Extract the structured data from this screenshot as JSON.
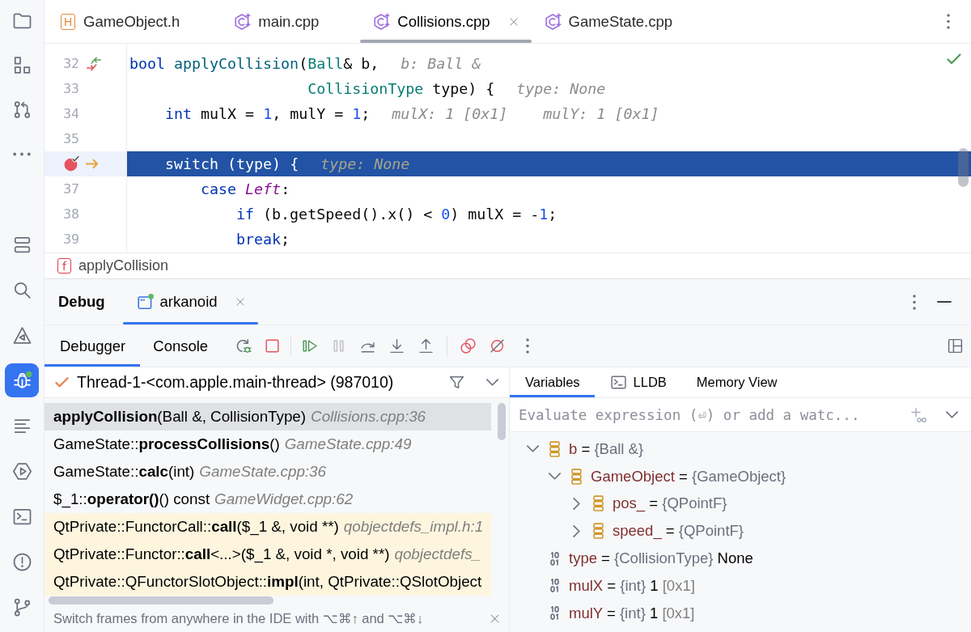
{
  "sidebar": {
    "top": [
      {
        "selected": false
      },
      {
        "selected": false
      },
      {
        "selected": false
      },
      {
        "selected": false
      }
    ],
    "bottom": [
      {
        "selected": false
      },
      {
        "selected": false
      },
      {
        "selected": false
      },
      {
        "selected": true
      },
      {
        "selected": false
      },
      {
        "selected": false
      },
      {
        "selected": false
      },
      {
        "selected": false
      },
      {
        "selected": false
      }
    ]
  },
  "editor": {
    "tabs": [
      {
        "label": "GameObject.h",
        "kind": "header",
        "badge": "H",
        "selected": false
      },
      {
        "label": "main.cpp",
        "kind": "source",
        "selected": false
      },
      {
        "label": "Collisions.cpp",
        "kind": "source",
        "selected": true
      },
      {
        "label": "GameState.cpp",
        "kind": "source",
        "selected": false
      }
    ],
    "lines": [
      {
        "number": "32",
        "navigation_marker": true,
        "breakpoint": false,
        "current": false,
        "tokens": [
          {
            "text": "bool",
            "kind": "keyword"
          },
          {
            "text": " applyCollision",
            "kind": "function"
          },
          {
            "text": "(",
            "kind": "plain"
          },
          {
            "text": "Ball",
            "kind": "type"
          },
          {
            "text": "& b,",
            "kind": "plain"
          }
        ],
        "hints": [
          "b: Ball &"
        ]
      },
      {
        "number": "33",
        "navigation_marker": false,
        "breakpoint": false,
        "current": false,
        "tokens": [
          {
            "text": "                    CollisionType",
            "kind": "type"
          },
          {
            "text": " type) {",
            "kind": "plain"
          }
        ],
        "hints": [
          "type: None"
        ]
      },
      {
        "number": "34",
        "navigation_marker": false,
        "breakpoint": false,
        "current": false,
        "tokens": [
          {
            "text": "    int",
            "kind": "keyword"
          },
          {
            "text": " mulX = ",
            "kind": "plain"
          },
          {
            "text": "1",
            "kind": "number"
          },
          {
            "text": ", mulY = ",
            "kind": "plain"
          },
          {
            "text": "1",
            "kind": "number"
          },
          {
            "text": ";",
            "kind": "plain"
          }
        ],
        "hints": [
          "mulX: 1 [0x1]",
          "mulY: 1 [0x1]"
        ]
      },
      {
        "number": "35",
        "navigation_marker": false,
        "breakpoint": false,
        "current": false
      },
      {
        "navigation_marker": false,
        "breakpoint": true,
        "current": true,
        "tokens": [
          {
            "text": "    switch",
            "kind": "keyword"
          },
          {
            "text": " (type) {",
            "kind": "plain"
          }
        ],
        "hints": [
          "type: None"
        ]
      },
      {
        "number": "37",
        "navigation_marker": false,
        "breakpoint": false,
        "current": false,
        "tokens": [
          {
            "text": "        case",
            "kind": "keyword"
          },
          {
            "text": " Left",
            "kind": "constant"
          },
          {
            "text": ":",
            "kind": "plain"
          }
        ]
      },
      {
        "number": "38",
        "navigation_marker": false,
        "breakpoint": false,
        "current": false,
        "tokens": [
          {
            "text": "            if",
            "kind": "keyword"
          },
          {
            "text": " (b.getSpeed().x() < ",
            "kind": "plain"
          },
          {
            "text": "0",
            "kind": "number"
          },
          {
            "text": ") mulX = -",
            "kind": "plain"
          },
          {
            "text": "1",
            "kind": "number"
          },
          {
            "text": ";",
            "kind": "plain"
          }
        ]
      },
      {
        "number": "39",
        "navigation_marker": false,
        "breakpoint": false,
        "current": false,
        "tokens": [
          {
            "text": "            break",
            "kind": "keyword"
          },
          {
            "text": ";",
            "kind": "plain"
          }
        ]
      }
    ]
  },
  "breadcrumb": {
    "badge": "f",
    "label": "applyCollision"
  },
  "debug": {
    "title": "Debug",
    "session_tabs": [
      {
        "label": "arkanoid",
        "selected": true
      }
    ],
    "view_tabs": [
      {
        "label": "Debugger",
        "selected": true
      },
      {
        "label": "Console",
        "selected": false
      }
    ],
    "toolbar": [
      {
        "disabled": false
      },
      {
        "disabled": false
      },
      {
        "disabled": false
      },
      {
        "disabled": true
      },
      {
        "disabled": false
      },
      {
        "disabled": false
      },
      {
        "disabled": false
      },
      {
        "disabled": false
      },
      {
        "disabled": false
      }
    ],
    "thread": "Thread-1-<com.apple.main-thread> (987010)",
    "frames": [
      {
        "method": "applyCollision",
        "args": "(Ball &, CollisionType)",
        "location": "Collisions.cpp:36",
        "selected": true,
        "library": false
      },
      {
        "scope": "GameState::",
        "method": "processCollisions",
        "args": "()",
        "location": "GameState.cpp:49",
        "selected": false,
        "library": false
      },
      {
        "scope": "GameState::",
        "method": "calc",
        "args": "(int)",
        "location": "GameState.cpp:36",
        "selected": false,
        "library": false
      },
      {
        "scope": "$_1::",
        "method": "operator()",
        "args": "() const",
        "location": "GameWidget.cpp:62",
        "selected": false,
        "library": false
      },
      {
        "scope": "QtPrivate::FunctorCall::",
        "method": "call",
        "args": "($_1 &, void **)",
        "location": "qobjectdefs_impl.h:1",
        "selected": false,
        "library": true
      },
      {
        "scope": "QtPrivate::Functor::",
        "method": "call",
        "args": "<...>($_1 &, void *, void **)",
        "location": "qobjectdefs_",
        "selected": false,
        "library": true
      },
      {
        "scope": "QtPrivate::QFunctorSlotObject::",
        "method": "impl",
        "args": "(int, QtPrivate::QSlotObject",
        "selected": false,
        "library": true
      }
    ],
    "hint": "Switch frames from anywhere in the IDE with ⌥⌘↑ and ⌥⌘↓",
    "variable_tabs": [
      {
        "label": "Variables",
        "kind": "plain",
        "selected": true
      },
      {
        "label": "LLDB",
        "kind": "console",
        "selected": false
      },
      {
        "label": "Memory View",
        "kind": "plain",
        "selected": false
      }
    ],
    "evaluate": {
      "placeholder": "Evaluate expression (⏎) or add a watc..."
    },
    "variables": [
      {
        "name": "b",
        "assign": "=",
        "type": "{Ball &}",
        "kind": "object",
        "expanded": true,
        "children": [
          {
            "name": "GameObject",
            "assign": "=",
            "type": "{GameObject}",
            "kind": "object",
            "expanded": true,
            "children": [
              {
                "name": "pos_",
                "assign": "=",
                "type": "{QPointF}",
                "kind": "object",
                "expanded": false
              },
              {
                "name": "speed_",
                "assign": "=",
                "type": "{QPointF}",
                "kind": "object",
                "expanded": false
              }
            ]
          }
        ]
      },
      {
        "name": "type",
        "assign": "=",
        "type": "{CollisionType}",
        "value": "None",
        "kind": "primitive"
      },
      {
        "name": "mulX",
        "assign": "=",
        "type": "{int}",
        "value": "1",
        "hex": "[0x1]",
        "kind": "primitive"
      },
      {
        "name": "mulY",
        "assign": "=",
        "type": "{int}",
        "value": "1",
        "hex": "[0x1]",
        "kind": "primitive"
      }
    ]
  }
}
